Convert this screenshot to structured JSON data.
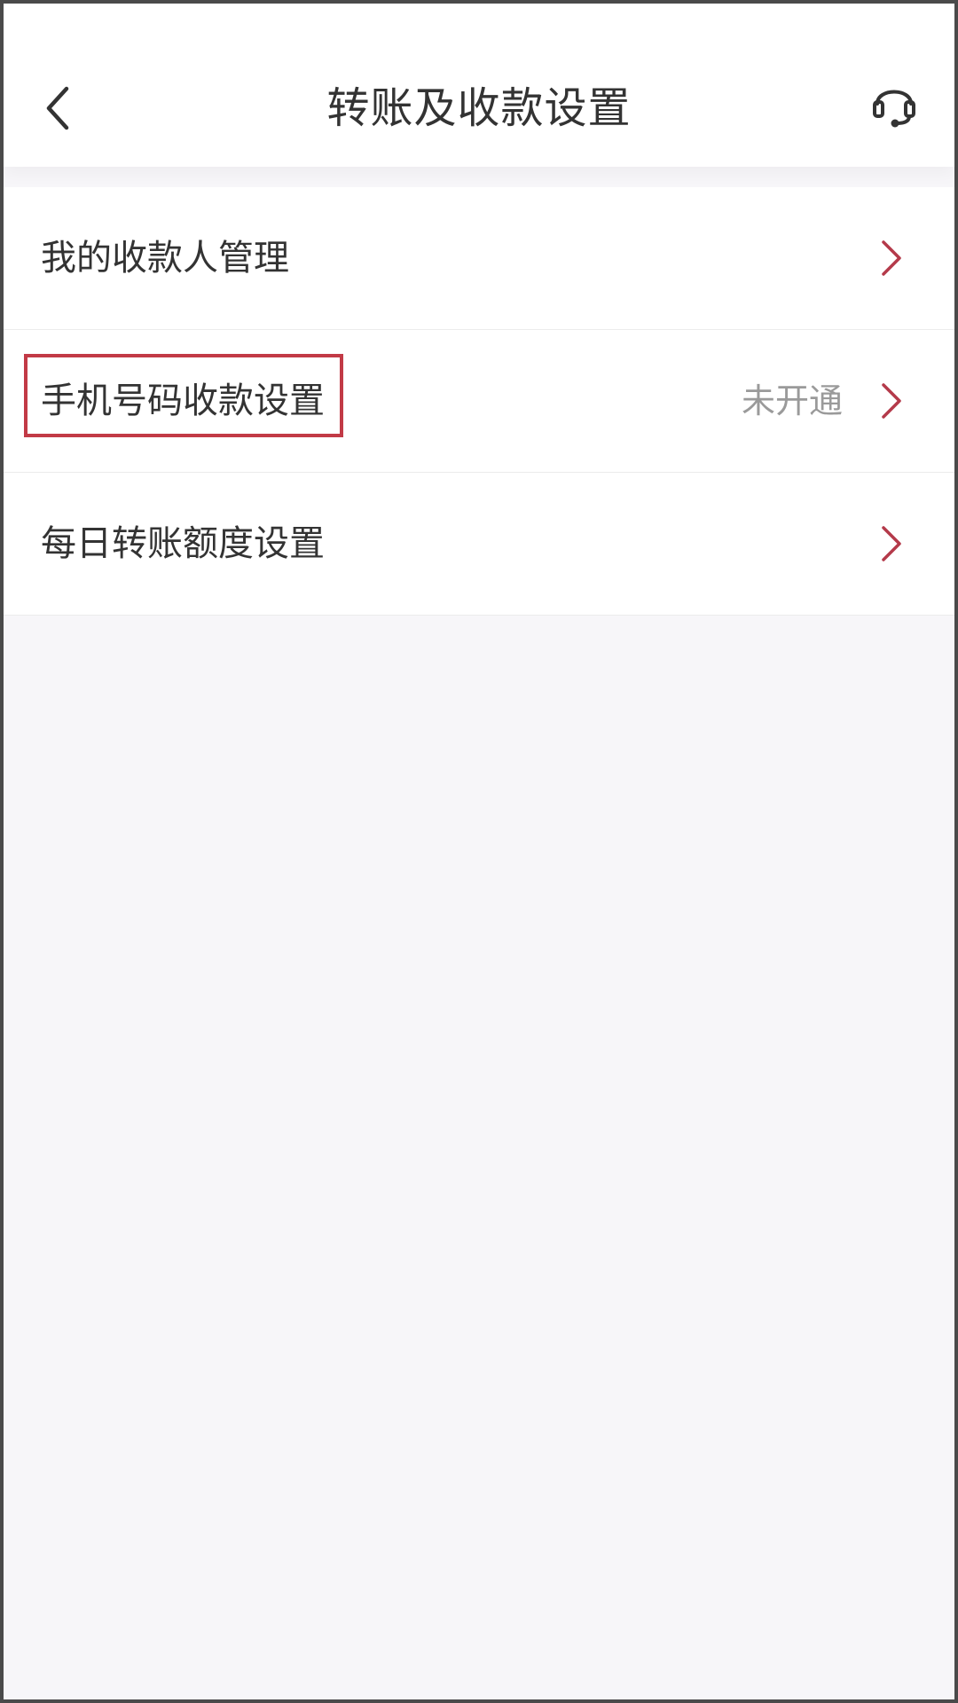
{
  "header": {
    "title": "转账及收款设置",
    "back_icon": "chevron-left-icon",
    "support_icon": "headset-icon"
  },
  "list": {
    "items": [
      {
        "label": "我的收款人管理",
        "status": "",
        "icon": "chevron-right-icon"
      },
      {
        "label": "手机号码收款设置",
        "status": "未开通",
        "icon": "chevron-right-icon",
        "highlighted": true
      },
      {
        "label": "每日转账额度设置",
        "status": "",
        "icon": "chevron-right-icon"
      }
    ]
  },
  "colors": {
    "accent": "#b43a4a",
    "highlight_border": "#c23a46",
    "background": "#f7f6f9",
    "text": "#333333",
    "muted": "#9a9a9a"
  }
}
